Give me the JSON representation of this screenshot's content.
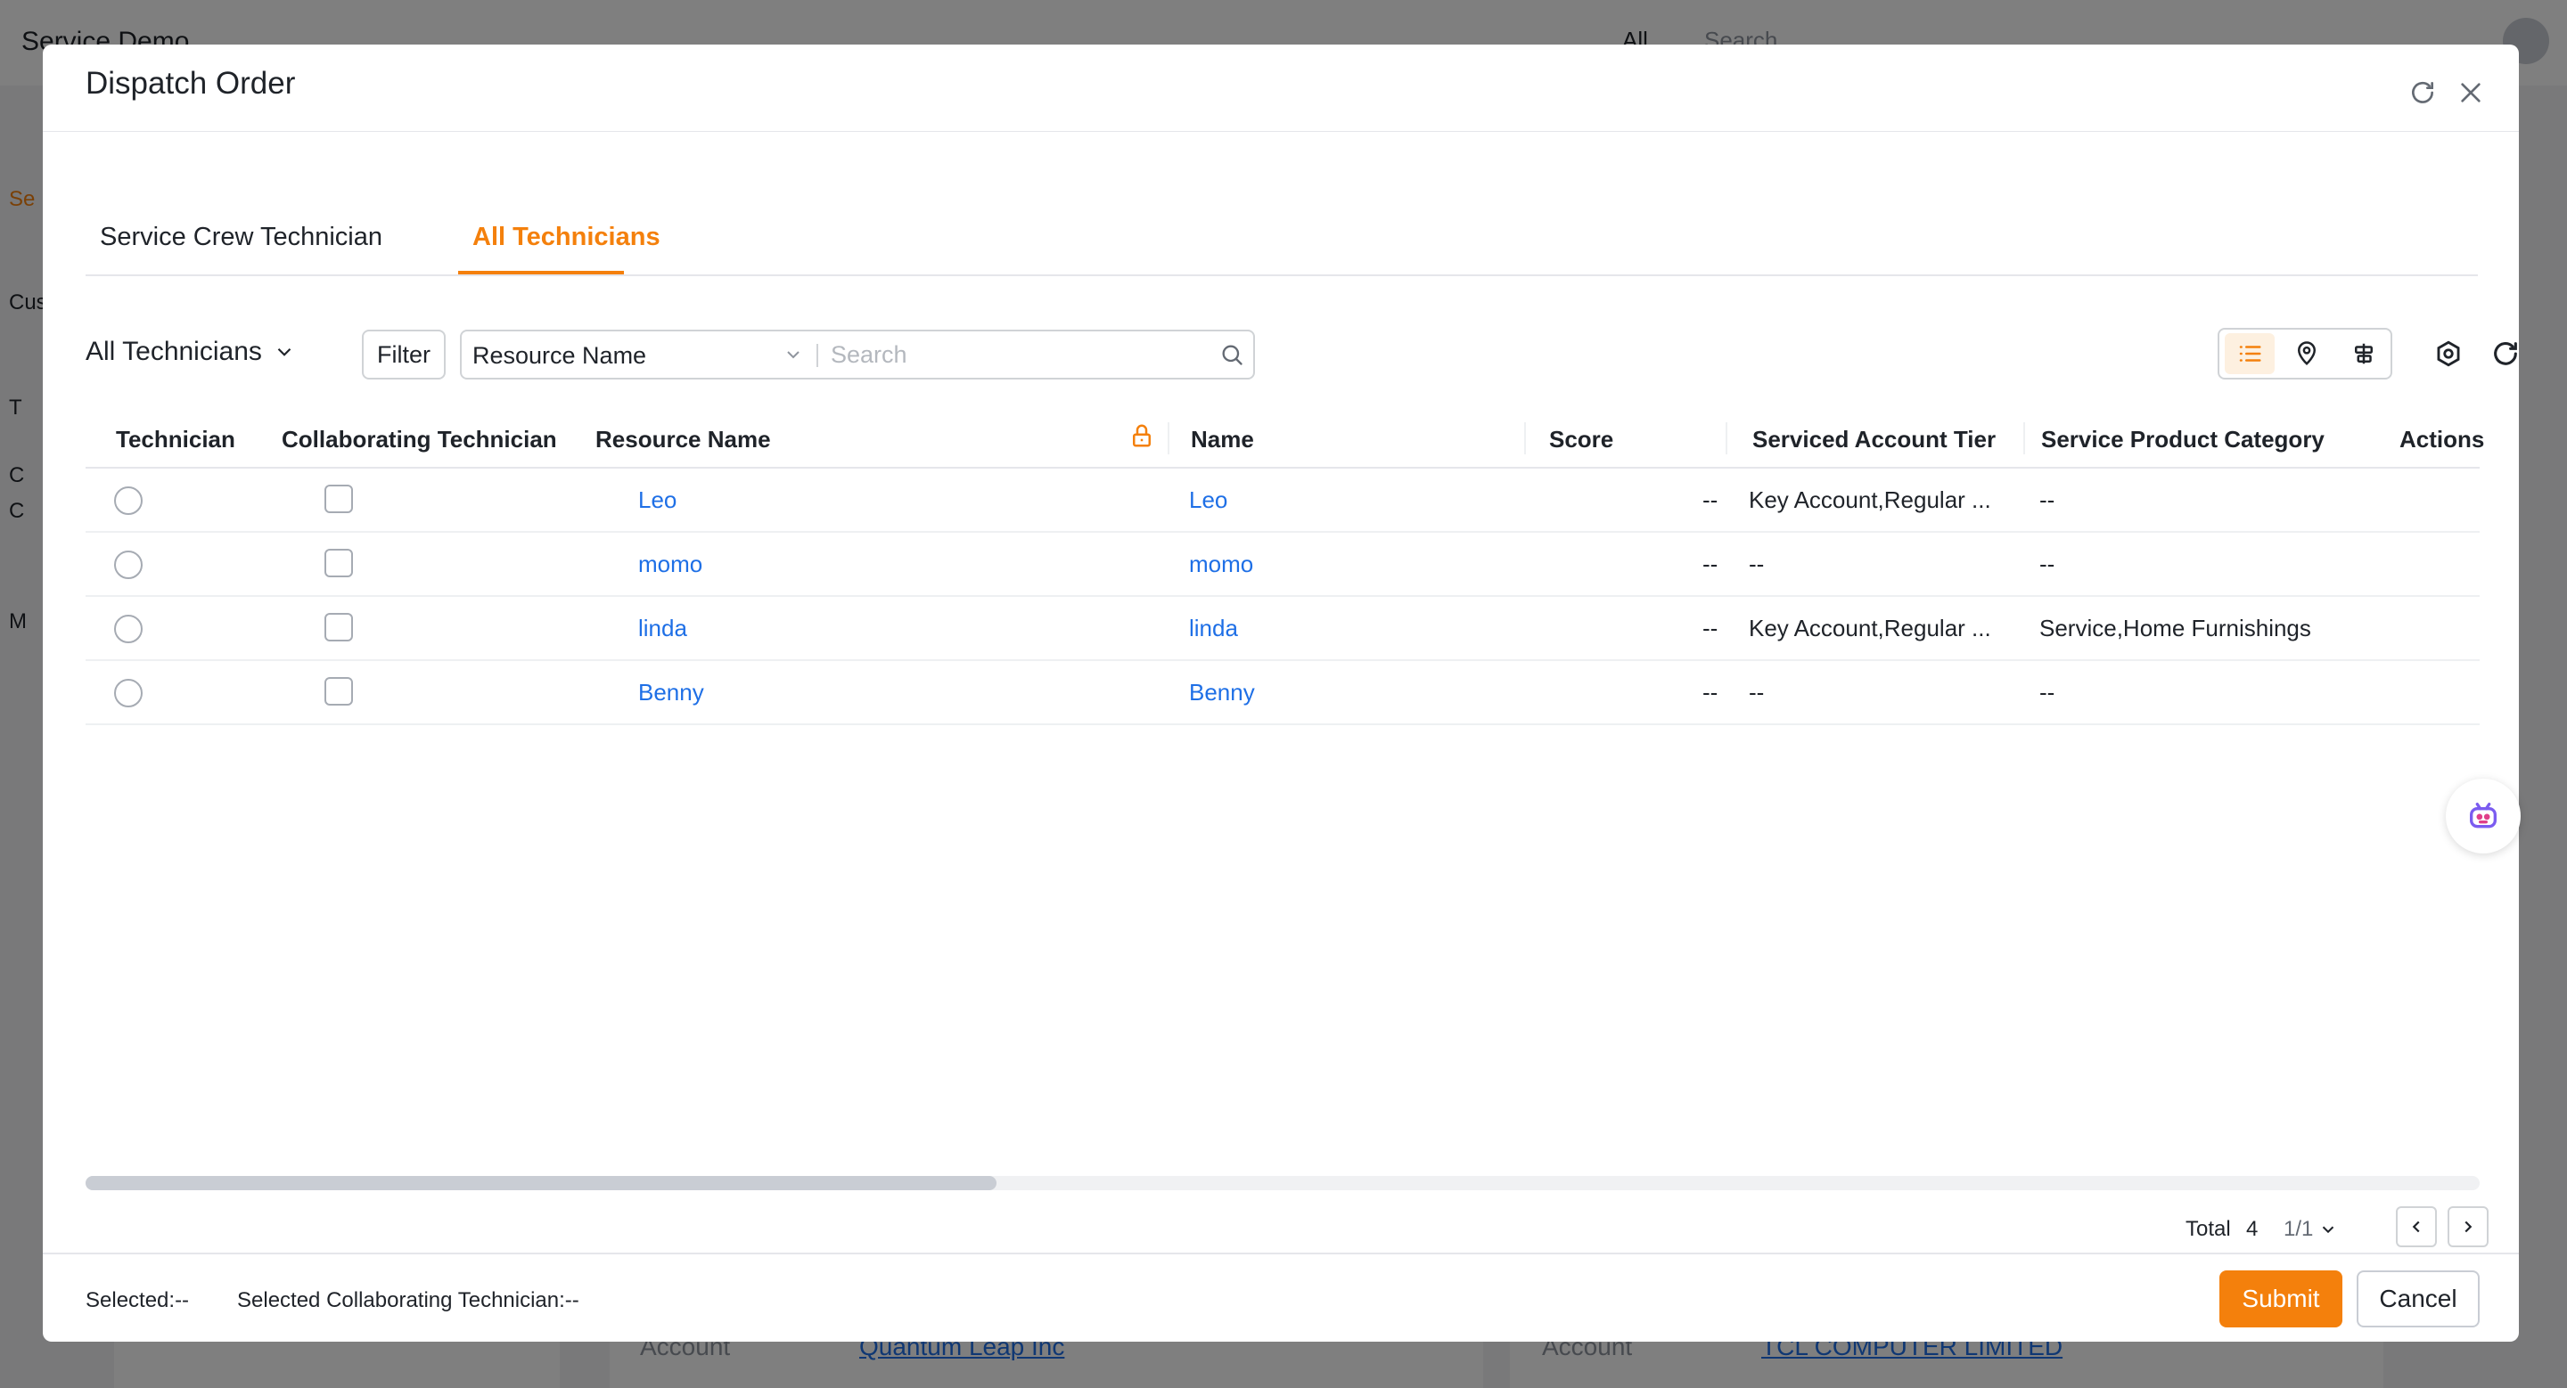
{
  "background_app": {
    "title": "Service Demo",
    "scope": "All",
    "search_placeholder": "Search",
    "side_labels": [
      "Se",
      "Cus",
      "T",
      "C",
      "C",
      "M"
    ],
    "bottom_cards": [
      {
        "label": "Account",
        "value": "Quantum Leap Inc"
      },
      {
        "label": "Account",
        "value": "TCL COMPUTER LIMITED"
      }
    ]
  },
  "modal": {
    "title": "Dispatch Order",
    "tabs": [
      {
        "label": "Service Crew Technician",
        "active": false
      },
      {
        "label": "All Technicians",
        "active": true
      }
    ],
    "toolbar": {
      "scope_select": "All Technicians",
      "filter_label": "Filter",
      "field_select": "Resource Name",
      "search_placeholder": "Search",
      "view_modes": [
        "list-icon",
        "map-pin-icon",
        "timeline-icon"
      ],
      "active_view": "list"
    },
    "table": {
      "columns": [
        "Technician",
        "Collaborating Technician",
        "Resource Name",
        "Name",
        "Score",
        "Serviced Account Tier",
        "Service Product Category",
        "Actions"
      ],
      "rows": [
        {
          "resource_name": "Leo",
          "name": "Leo",
          "score": "--",
          "tier": "Key Account,Regular ...",
          "category": "--"
        },
        {
          "resource_name": "momo",
          "name": "momo",
          "score": "--",
          "tier": "--",
          "category": "--"
        },
        {
          "resource_name": "linda",
          "name": "linda",
          "score": "--",
          "tier": "Key Account,Regular ...",
          "category": "Service,Home Furnishings"
        },
        {
          "resource_name": "Benny",
          "name": "Benny",
          "score": "--",
          "tier": "--",
          "category": "--"
        }
      ]
    },
    "pagination": {
      "total_label": "Total",
      "total": "4",
      "page": "1/1"
    },
    "footer": {
      "selected": "Selected:--",
      "selected_collab": "Selected Collaborating Technician:--",
      "submit_label": "Submit",
      "cancel_label": "Cancel"
    }
  },
  "colors": {
    "accent": "#f4800c",
    "link": "#1e6fe6",
    "text": "#1f2329"
  }
}
